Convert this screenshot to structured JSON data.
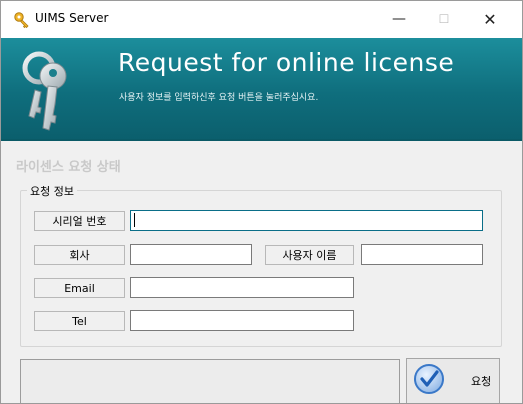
{
  "window": {
    "title": "UIMS Server",
    "minimize_glyph": "—",
    "maximize_glyph": "☐",
    "close_glyph": "✕"
  },
  "banner": {
    "title": "Request for online license",
    "subtitle": "사용자 정보를 입력하신후 요청 버튼을 눌러주십시요."
  },
  "status_label": "라이센스 요청 상태",
  "request_info": {
    "legend": "요청 정보",
    "serial_label": "시리얼 번호",
    "serial_value": "",
    "company_label": "회사",
    "company_value": "",
    "username_label": "사용자 이름",
    "username_value": "",
    "email_label": "Email",
    "email_value": "",
    "tel_label": "Tel",
    "tel_value": ""
  },
  "request_button": {
    "label": "요청",
    "icon": "checkmark-icon"
  },
  "icons": {
    "app": "key-icon",
    "banner": "keys-icon"
  },
  "colors": {
    "banner": "#0f6e7d",
    "accent": "#2f7fd6"
  }
}
